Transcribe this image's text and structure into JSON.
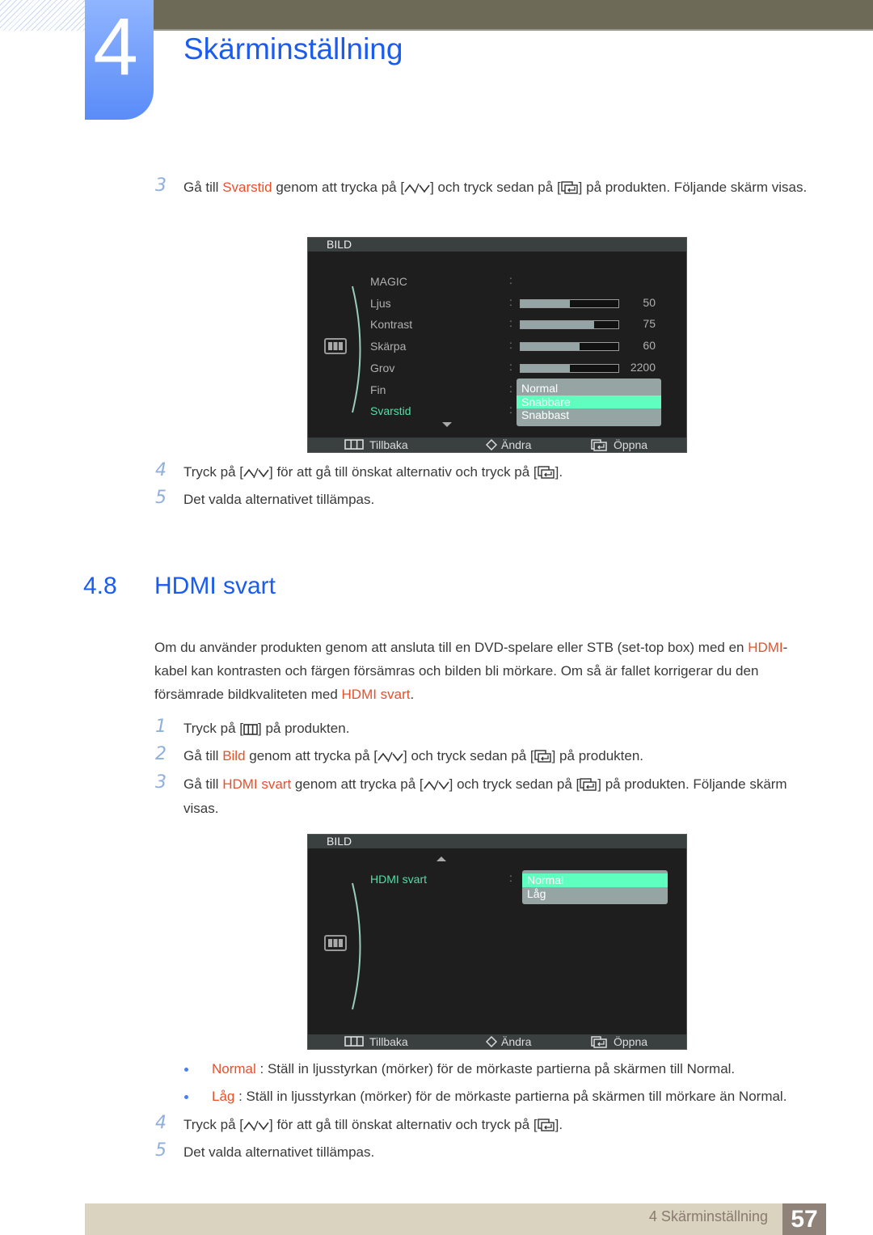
{
  "header": {
    "chapter_number": "4",
    "chapter_title": "Skärminställning"
  },
  "steps_a": [
    {
      "n": "3",
      "parts": [
        "Gå till ",
        {
          "hl": "Svarstid"
        },
        " genom att trycka på [",
        {
          "icon": "updown"
        },
        "] och tryck sedan på [",
        {
          "icon": "enter"
        },
        "] på produkten. Följande skärm visas."
      ]
    }
  ],
  "osd1": {
    "title": "BILD",
    "items": [
      {
        "label": "MAGIC"
      },
      {
        "label": "Ljus",
        "value": "50",
        "fill": 50
      },
      {
        "label": "Kontrast",
        "value": "75",
        "fill": 75
      },
      {
        "label": "Skärpa",
        "value": "60",
        "fill": 60
      },
      {
        "label": "Grov",
        "value": "2200",
        "fill": 50
      },
      {
        "label": "Fin"
      },
      {
        "label": "Svarstid",
        "selected": true
      }
    ],
    "options": [
      "Normal",
      "Snabbare",
      "Snabbast"
    ],
    "selected_option": "Snabbare",
    "footer": {
      "back": "Tillbaka",
      "change": "Ändra",
      "open": "Öppna"
    }
  },
  "steps_b": [
    {
      "n": "4",
      "parts": [
        "Tryck på [",
        {
          "icon": "updown"
        },
        "] för att gå till önskat alternativ och tryck på [",
        {
          "icon": "enter"
        },
        "]."
      ]
    },
    {
      "n": "5",
      "parts": [
        "Det valda alternativet tillämpas."
      ]
    }
  ],
  "section": {
    "number": "4.8",
    "title": "HDMI svart"
  },
  "intro": [
    "Om du använder produkten genom att ansluta till en DVD-spelare eller STB (set-top box) med en ",
    {
      "hl": "HDMI"
    },
    "-kabel kan kontrasten och färgen försämras och bilden bli mörkare. Om så är fallet korrigerar du den försämrade bildkvaliteten med ",
    {
      "hl": "HDMI svart"
    },
    "."
  ],
  "steps_c": [
    {
      "n": "1",
      "parts": [
        "Tryck på [",
        {
          "icon": "menu"
        },
        "] på produkten."
      ]
    },
    {
      "n": "2",
      "parts": [
        "Gå till ",
        {
          "hl": "Bild"
        },
        " genom att trycka på [",
        {
          "icon": "updown"
        },
        "] och tryck sedan på [",
        {
          "icon": "enter"
        },
        "] på produkten."
      ]
    },
    {
      "n": "3",
      "parts": [
        "Gå till ",
        {
          "hl": "HDMI svart"
        },
        " genom att trycka på [",
        {
          "icon": "updown"
        },
        "] och tryck sedan på [",
        {
          "icon": "enter"
        },
        "] på produkten. Följande skärm visas."
      ]
    }
  ],
  "osd2": {
    "title": "BILD",
    "item": "HDMI svart",
    "options": [
      "Normal",
      "Låg"
    ],
    "selected_option": "Normal",
    "footer": {
      "back": "Tillbaka",
      "change": "Ändra",
      "open": "Öppna"
    }
  },
  "bullets": [
    {
      "parts": [
        {
          "hl": "Normal"
        },
        " : Ställ in ljusstyrkan (mörker) för de mörkaste partierna på skärmen till Normal."
      ]
    },
    {
      "parts": [
        {
          "hl": "Låg"
        },
        " : Ställ in ljusstyrkan (mörker) för de mörkaste partierna på skärmen till mörkare än Normal."
      ]
    }
  ],
  "steps_d": [
    {
      "n": "4",
      "parts": [
        "Tryck på [",
        {
          "icon": "updown"
        },
        "] för att gå till önskat alternativ och tryck på [",
        {
          "icon": "enter"
        },
        "]."
      ]
    },
    {
      "n": "5",
      "parts": [
        "Det valda alternativet tillämpas."
      ]
    }
  ],
  "footer": {
    "chapter": "4 Skärminställning",
    "page": "57"
  },
  "colors": {
    "accent": "#1a5cf0",
    "highlight": "#e8502a",
    "osd_selected": "#5fffbf"
  }
}
